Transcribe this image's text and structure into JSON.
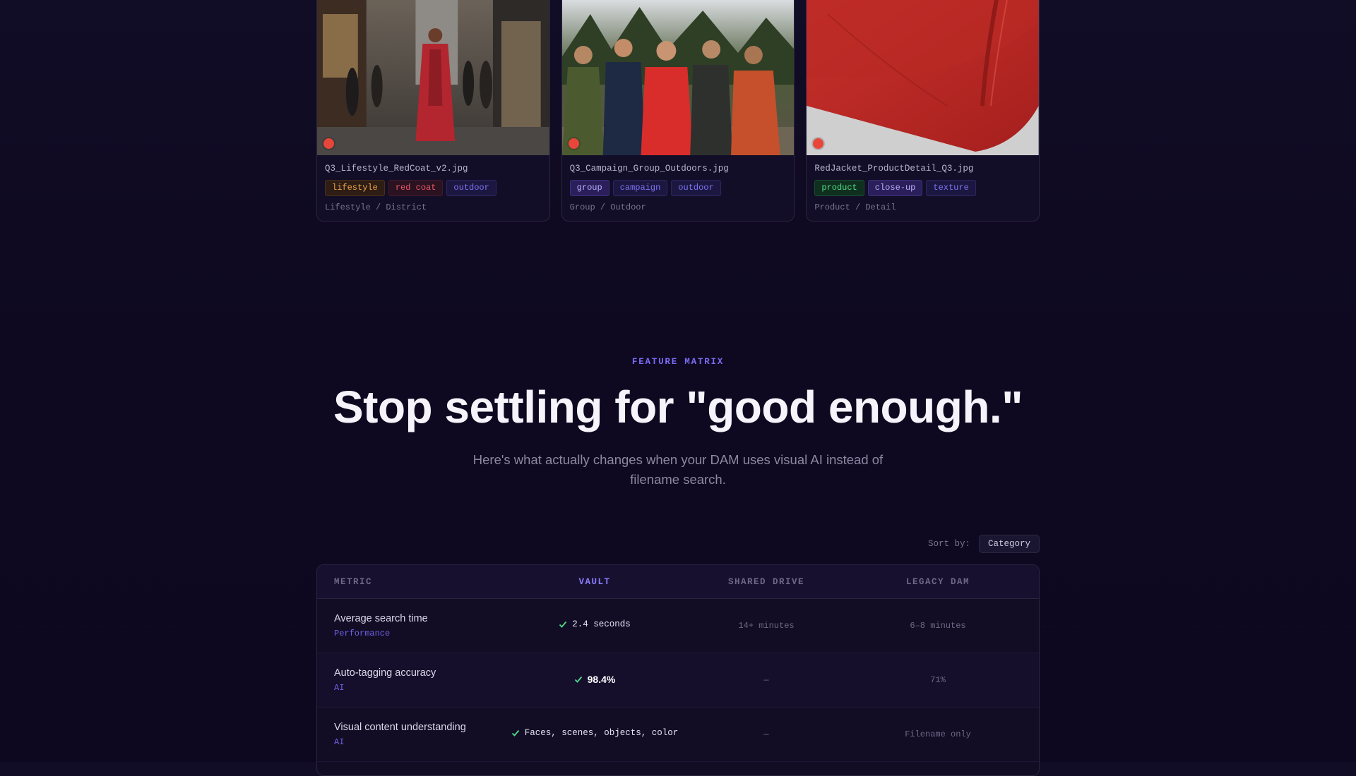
{
  "cards": [
    {
      "filename": "Q3_Lifestyle_RedCoat_v2.jpg",
      "tags": [
        {
          "label": "lifestyle",
          "color": "#f3a44c"
        },
        {
          "label": "red coat",
          "color": "#f0586a"
        },
        {
          "label": "outdoor",
          "color": "#7d74f5"
        }
      ],
      "category_path": "Lifestyle / District"
    },
    {
      "filename": "Q3_Campaign_Group_Outdoors.jpg",
      "tags": [
        {
          "label": "group",
          "color": "#b9b0ff"
        },
        {
          "label": "campaign",
          "color": "#7d74f5"
        },
        {
          "label": "outdoor",
          "color": "#7d74f5"
        }
      ],
      "category_path": "Group / Outdoor"
    },
    {
      "filename": "RedJacket_ProductDetail_Q3.jpg",
      "tags": [
        {
          "label": "product",
          "color": "#4fdc8a"
        },
        {
          "label": "close-up",
          "color": "#b9b0ff"
        },
        {
          "label": "texture",
          "color": "#7d74f5"
        }
      ],
      "category_path": "Product / Detail"
    }
  ],
  "feature": {
    "eyebrow": "FEATURE MATRIX",
    "headline": "Stop settling for \"good enough.\"",
    "subtitle": "Here's what actually changes when your DAM uses visual AI instead of filename search."
  },
  "sort": {
    "label": "Sort by:",
    "value": "Category"
  },
  "matrix": {
    "columns": [
      "METRIC",
      "VAULT",
      "SHARED DRIVE",
      "LEGACY DAM"
    ],
    "rows": [
      {
        "metric": "Average search time",
        "category": "Performance",
        "vault": "2.4 seconds",
        "shared": "14+ minutes",
        "legacy": "6–8 minutes"
      },
      {
        "metric": "Auto-tagging accuracy",
        "category": "AI",
        "vault": "98.4%",
        "shared": "—",
        "legacy": "71%"
      },
      {
        "metric": "Visual content understanding",
        "category": "AI",
        "vault": "Faces, scenes, objects, color",
        "shared": "—",
        "legacy": "Filename only"
      }
    ]
  },
  "colors": {
    "accent": "#7a6cf5",
    "check": "#4fdc8a",
    "status_dot": "#e8463a",
    "background": "#0f0a22"
  }
}
